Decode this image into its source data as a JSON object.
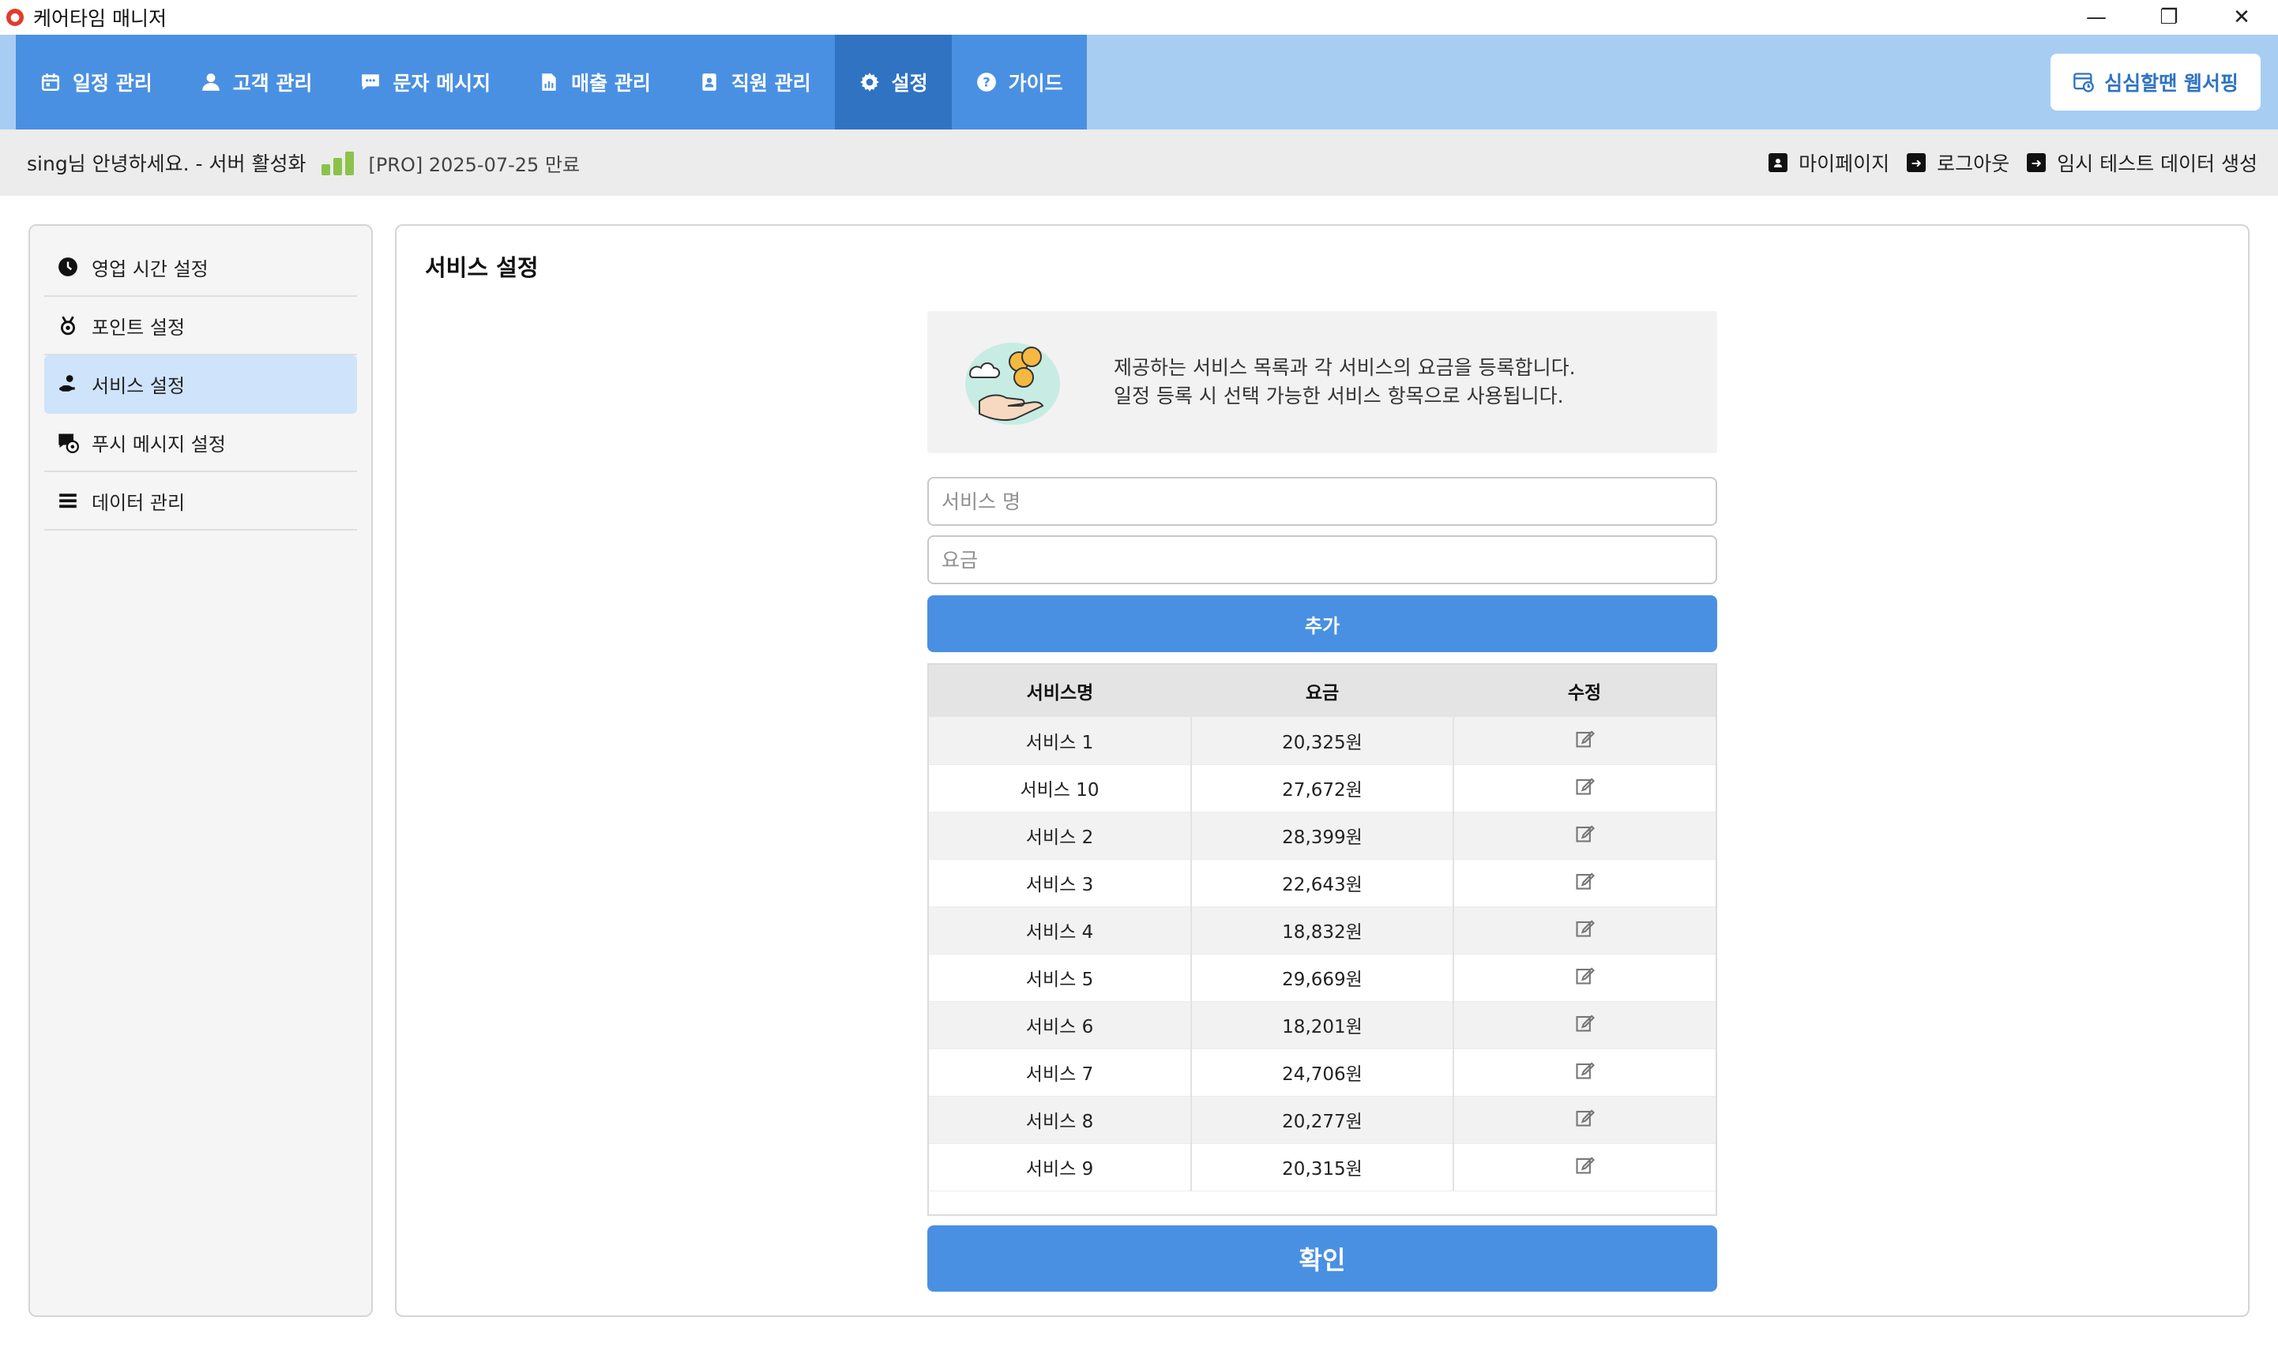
{
  "window": {
    "title": "케어타임 매니저",
    "minimize": "—",
    "restore": "❐",
    "close": "✕"
  },
  "nav": {
    "items": [
      {
        "label": "일정 관리",
        "icon": "calendar-icon"
      },
      {
        "label": "고객 관리",
        "icon": "person-icon"
      },
      {
        "label": "문자 메시지",
        "icon": "chat-icon"
      },
      {
        "label": "매출 관리",
        "icon": "document-chart-icon"
      },
      {
        "label": "직원 관리",
        "icon": "badge-icon"
      },
      {
        "label": "설정",
        "icon": "gear-icon",
        "active": true
      },
      {
        "label": "가이드",
        "icon": "help-icon"
      }
    ],
    "web_button": "심심할땐 웹서핑"
  },
  "status": {
    "greeting": "sing님 안녕하세요. - 서버 활성화",
    "plan": "[PRO] 2025-07-25 만료",
    "links": {
      "mypage": "마이페이지",
      "logout": "로그아웃",
      "test_data": "임시 테스트 데이터 생성"
    }
  },
  "sidebar": {
    "items": [
      {
        "label": "영업 시간 설정",
        "icon": "clock-icon"
      },
      {
        "label": "포인트 설정",
        "icon": "medal-icon"
      },
      {
        "label": "서비스 설정",
        "icon": "hand-service-icon",
        "active": true
      },
      {
        "label": "푸시 메시지 설정",
        "icon": "push-settings-icon"
      },
      {
        "label": "데이터 관리",
        "icon": "list-icon"
      }
    ]
  },
  "main": {
    "title": "서비스 설정",
    "info_line1": "제공하는 서비스 목록과 각 서비스의 요금을 등록합니다.",
    "info_line2": "일정 등록 시 선택 가능한 서비스 항목으로 사용됩니다.",
    "service_name_placeholder": "서비스 명",
    "price_placeholder": "요금",
    "add_label": "추가",
    "table": {
      "headers": {
        "name": "서비스명",
        "price": "요금",
        "edit": "수정"
      },
      "rows": [
        {
          "name": "서비스 1",
          "price": "20,325원"
        },
        {
          "name": "서비스 10",
          "price": "27,672원"
        },
        {
          "name": "서비스 2",
          "price": "28,399원"
        },
        {
          "name": "서비스 3",
          "price": "22,643원"
        },
        {
          "name": "서비스 4",
          "price": "18,832원"
        },
        {
          "name": "서비스 5",
          "price": "29,669원"
        },
        {
          "name": "서비스 6",
          "price": "18,201원"
        },
        {
          "name": "서비스 7",
          "price": "24,706원"
        },
        {
          "name": "서비스 8",
          "price": "20,277원"
        },
        {
          "name": "서비스 9",
          "price": "20,315원"
        }
      ]
    },
    "confirm_label": "확인"
  }
}
